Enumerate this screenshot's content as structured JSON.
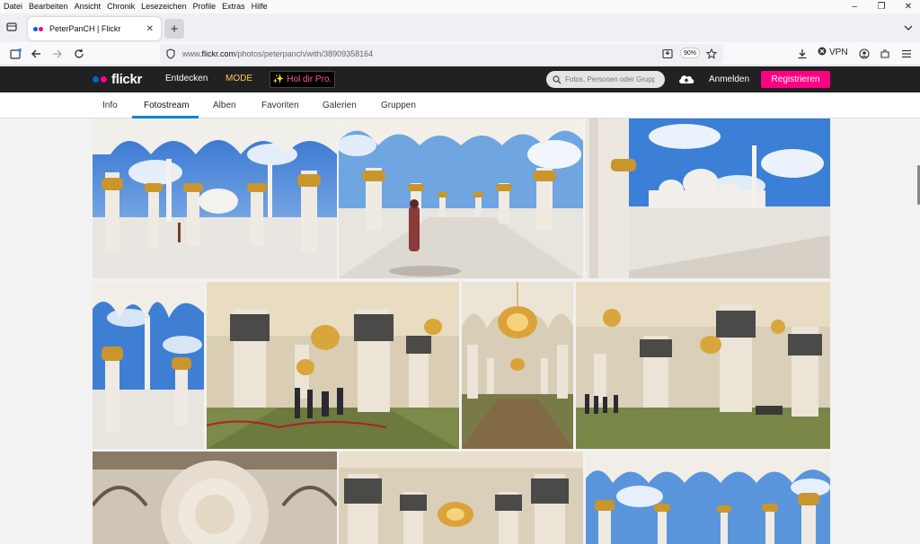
{
  "menu": [
    "Datei",
    "Bearbeiten",
    "Ansicht",
    "Chronik",
    "Lesezeichen",
    "Profile",
    "Extras",
    "Hilfe"
  ],
  "window_controls": {
    "minimize": "–",
    "restore": "❐",
    "close": "✕"
  },
  "tab": {
    "title": "PeterPanCH | Flickr",
    "close": "✕"
  },
  "new_tab_label": "+",
  "url": {
    "prefix": "www.",
    "domain": "flickr.com",
    "path": "/photos/peterpanch/with/38909358164"
  },
  "zoom": "90%",
  "vpn_label": "VPN",
  "flickr": {
    "logo": "flickr",
    "nav_explore": "Entdecken",
    "nav_mode": "MODE",
    "pro_label": "Hol dir Pro.",
    "search_placeholder": "Fotos, Personen oder Gruppen",
    "login": "Anmelden",
    "register": "Registrieren"
  },
  "subnav": [
    "Info",
    "Fotostream",
    "Alben",
    "Favoriten",
    "Galerien",
    "Gruppen"
  ],
  "active_subnav": "Fotostream",
  "colors": {
    "flickr_blue": "#0063dc",
    "flickr_pink": "#ff0084",
    "header_bg": "#212124",
    "accent_underline": "#0c84d6",
    "mode_yellow": "#ffc84f"
  },
  "photos": [
    "mosque-courtyard-arches",
    "mosque-colonnade-corridor",
    "mosque-exterior-domes",
    "mosque-minaret-arch",
    "prayer-hall-chandelier-visitors",
    "prayer-hall-chandelier",
    "prayer-hall-columns-visitors",
    "dome-interior",
    "hall-chandelier-columns",
    "outdoor-colonnade"
  ]
}
